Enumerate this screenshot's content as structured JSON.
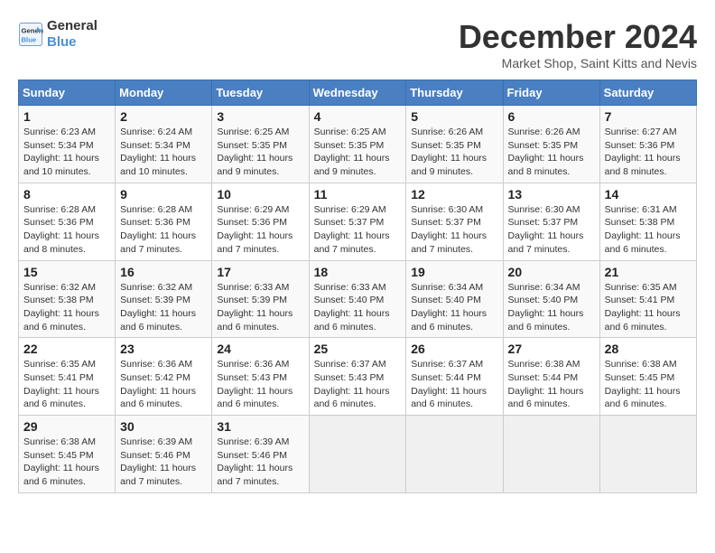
{
  "header": {
    "logo_line1": "General",
    "logo_line2": "Blue",
    "month_title": "December 2024",
    "location": "Market Shop, Saint Kitts and Nevis"
  },
  "days_of_week": [
    "Sunday",
    "Monday",
    "Tuesday",
    "Wednesday",
    "Thursday",
    "Friday",
    "Saturday"
  ],
  "weeks": [
    [
      {
        "day": "1",
        "sunrise": "6:23 AM",
        "sunset": "5:34 PM",
        "daylight": "11 hours and 10 minutes."
      },
      {
        "day": "2",
        "sunrise": "6:24 AM",
        "sunset": "5:34 PM",
        "daylight": "11 hours and 10 minutes."
      },
      {
        "day": "3",
        "sunrise": "6:25 AM",
        "sunset": "5:35 PM",
        "daylight": "11 hours and 9 minutes."
      },
      {
        "day": "4",
        "sunrise": "6:25 AM",
        "sunset": "5:35 PM",
        "daylight": "11 hours and 9 minutes."
      },
      {
        "day": "5",
        "sunrise": "6:26 AM",
        "sunset": "5:35 PM",
        "daylight": "11 hours and 9 minutes."
      },
      {
        "day": "6",
        "sunrise": "6:26 AM",
        "sunset": "5:35 PM",
        "daylight": "11 hours and 8 minutes."
      },
      {
        "day": "7",
        "sunrise": "6:27 AM",
        "sunset": "5:36 PM",
        "daylight": "11 hours and 8 minutes."
      }
    ],
    [
      {
        "day": "8",
        "sunrise": "6:28 AM",
        "sunset": "5:36 PM",
        "daylight": "11 hours and 8 minutes."
      },
      {
        "day": "9",
        "sunrise": "6:28 AM",
        "sunset": "5:36 PM",
        "daylight": "11 hours and 7 minutes."
      },
      {
        "day": "10",
        "sunrise": "6:29 AM",
        "sunset": "5:36 PM",
        "daylight": "11 hours and 7 minutes."
      },
      {
        "day": "11",
        "sunrise": "6:29 AM",
        "sunset": "5:37 PM",
        "daylight": "11 hours and 7 minutes."
      },
      {
        "day": "12",
        "sunrise": "6:30 AM",
        "sunset": "5:37 PM",
        "daylight": "11 hours and 7 minutes."
      },
      {
        "day": "13",
        "sunrise": "6:30 AM",
        "sunset": "5:37 PM",
        "daylight": "11 hours and 7 minutes."
      },
      {
        "day": "14",
        "sunrise": "6:31 AM",
        "sunset": "5:38 PM",
        "daylight": "11 hours and 6 minutes."
      }
    ],
    [
      {
        "day": "15",
        "sunrise": "6:32 AM",
        "sunset": "5:38 PM",
        "daylight": "11 hours and 6 minutes."
      },
      {
        "day": "16",
        "sunrise": "6:32 AM",
        "sunset": "5:39 PM",
        "daylight": "11 hours and 6 minutes."
      },
      {
        "day": "17",
        "sunrise": "6:33 AM",
        "sunset": "5:39 PM",
        "daylight": "11 hours and 6 minutes."
      },
      {
        "day": "18",
        "sunrise": "6:33 AM",
        "sunset": "5:40 PM",
        "daylight": "11 hours and 6 minutes."
      },
      {
        "day": "19",
        "sunrise": "6:34 AM",
        "sunset": "5:40 PM",
        "daylight": "11 hours and 6 minutes."
      },
      {
        "day": "20",
        "sunrise": "6:34 AM",
        "sunset": "5:40 PM",
        "daylight": "11 hours and 6 minutes."
      },
      {
        "day": "21",
        "sunrise": "6:35 AM",
        "sunset": "5:41 PM",
        "daylight": "11 hours and 6 minutes."
      }
    ],
    [
      {
        "day": "22",
        "sunrise": "6:35 AM",
        "sunset": "5:41 PM",
        "daylight": "11 hours and 6 minutes."
      },
      {
        "day": "23",
        "sunrise": "6:36 AM",
        "sunset": "5:42 PM",
        "daylight": "11 hours and 6 minutes."
      },
      {
        "day": "24",
        "sunrise": "6:36 AM",
        "sunset": "5:43 PM",
        "daylight": "11 hours and 6 minutes."
      },
      {
        "day": "25",
        "sunrise": "6:37 AM",
        "sunset": "5:43 PM",
        "daylight": "11 hours and 6 minutes."
      },
      {
        "day": "26",
        "sunrise": "6:37 AM",
        "sunset": "5:44 PM",
        "daylight": "11 hours and 6 minutes."
      },
      {
        "day": "27",
        "sunrise": "6:38 AM",
        "sunset": "5:44 PM",
        "daylight": "11 hours and 6 minutes."
      },
      {
        "day": "28",
        "sunrise": "6:38 AM",
        "sunset": "5:45 PM",
        "daylight": "11 hours and 6 minutes."
      }
    ],
    [
      {
        "day": "29",
        "sunrise": "6:38 AM",
        "sunset": "5:45 PM",
        "daylight": "11 hours and 6 minutes."
      },
      {
        "day": "30",
        "sunrise": "6:39 AM",
        "sunset": "5:46 PM",
        "daylight": "11 hours and 7 minutes."
      },
      {
        "day": "31",
        "sunrise": "6:39 AM",
        "sunset": "5:46 PM",
        "daylight": "11 hours and 7 minutes."
      },
      null,
      null,
      null,
      null
    ]
  ]
}
